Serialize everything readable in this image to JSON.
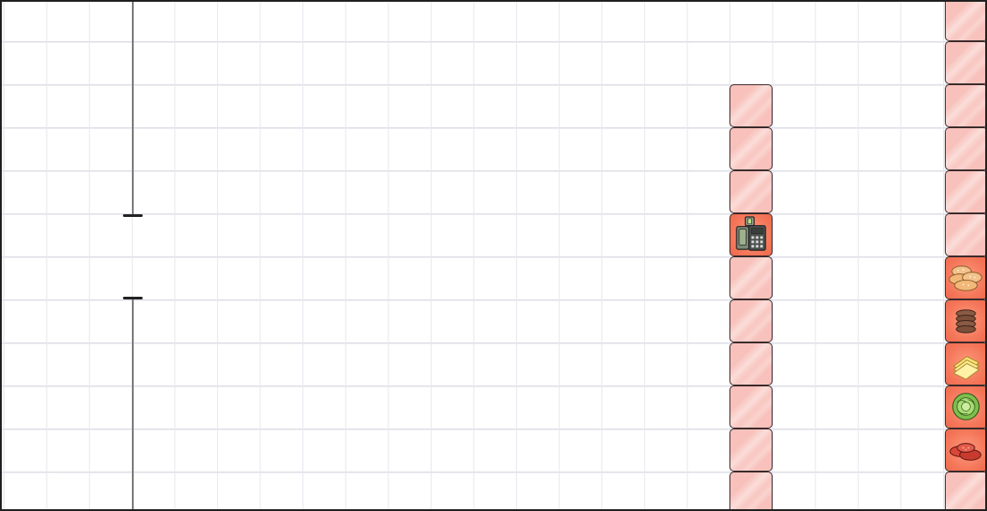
{
  "board": {
    "grid": true,
    "colors": {
      "background": "#ffffff",
      "grid_line": "#dcdce6",
      "counter": "#f8c1bb",
      "station": "#f47558",
      "outline": "#3a2a2a",
      "wall": "#7a7a7a"
    }
  },
  "middle_counter": {
    "tile_count": 10,
    "stations": [
      {
        "index": 3,
        "icon": "cash-register-icon"
      }
    ]
  },
  "right_counter": {
    "tile_count": 12,
    "stations": [
      {
        "index": 6,
        "icon": "burger-buns-icon"
      },
      {
        "index": 7,
        "icon": "burger-patties-icon"
      },
      {
        "index": 8,
        "icon": "cheese-slices-icon"
      },
      {
        "index": 9,
        "icon": "lettuce-icon"
      },
      {
        "index": 10,
        "icon": "tomato-slices-icon"
      }
    ]
  }
}
